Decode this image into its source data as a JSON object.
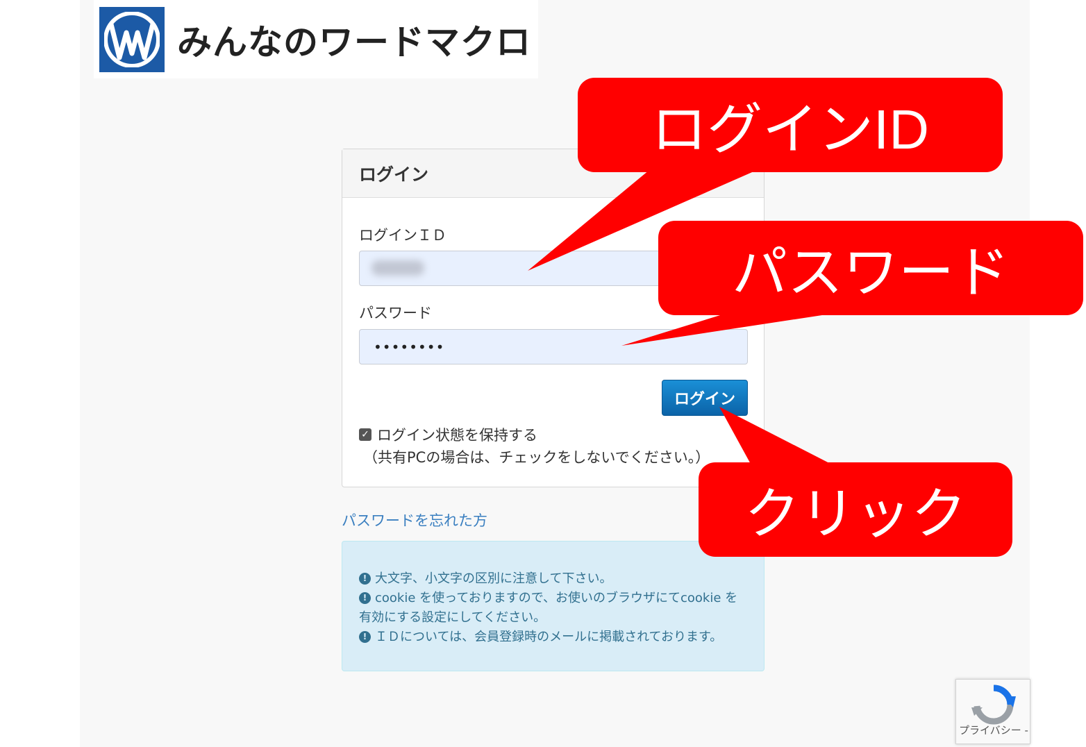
{
  "logo": {
    "text": "みんなのワードマクロ",
    "icon": "wm-logo-icon"
  },
  "login": {
    "title": "ログイン",
    "id_label": "ログインＩＤ",
    "password_label": "パスワード",
    "password_value": "••••••••",
    "button_label": "ログイン",
    "remember_label": "ログイン状態を保持する",
    "remember_note": "（共有PCの場合は、チェックをしないでください。）",
    "remember_checked": true
  },
  "forgot_link": "パスワードを忘れた方",
  "info": {
    "line1": "大文字、小文字の区別に注意して下さい。",
    "line2a": "cookie を使っておりますので、お使いのブラウザにてcookie を",
    "line2b": "有効にする設定にしてください。",
    "line3": "ＩＤについては、会員登録時のメールに掲載されております。"
  },
  "callouts": {
    "login_id": "ログインID",
    "password": "パスワード",
    "click": "クリック",
    "color": "#ff0000"
  },
  "recaptcha": {
    "text": "プライバシー - 利用規約"
  },
  "colors": {
    "button": "#0b63a8",
    "link": "#3a7fc0",
    "info_bg": "#d9edf7",
    "input_bg": "#e8f0fe",
    "logo_blue": "#1c5aa6"
  }
}
